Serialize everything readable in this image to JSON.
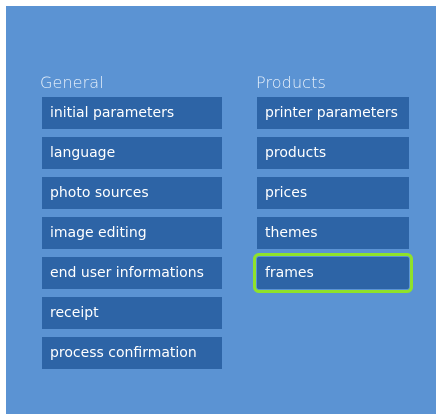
{
  "general": {
    "title": "General",
    "items": [
      {
        "label": "initial parameters"
      },
      {
        "label": "language"
      },
      {
        "label": "photo sources"
      },
      {
        "label": "image editing"
      },
      {
        "label": "end user informations"
      },
      {
        "label": "receipt"
      },
      {
        "label": "process confirmation"
      }
    ]
  },
  "products": {
    "title": "Products",
    "items": [
      {
        "label": "printer parameters"
      },
      {
        "label": "products"
      },
      {
        "label": "prices"
      },
      {
        "label": "themes"
      },
      {
        "label": "frames",
        "selected": true
      }
    ]
  },
  "colors": {
    "panel_background": "#5b93d3",
    "tile_background": "#2d64a6",
    "selection_outline": "#8fe22a",
    "text": "#ffffff"
  }
}
